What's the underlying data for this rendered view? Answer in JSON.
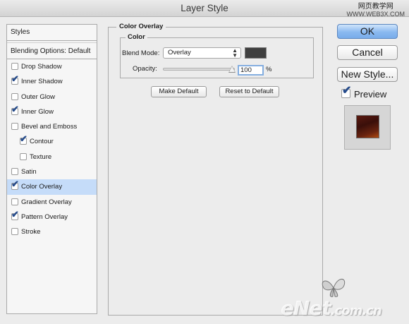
{
  "window": {
    "title": "Layer Style"
  },
  "watermark_top": {
    "line1": "网页教学网",
    "line2": "WWW.WEB3X.COM"
  },
  "left_panel": {
    "styles_label": "Styles",
    "blending_label": "Blending Options: Default",
    "items": [
      {
        "label": "Drop Shadow",
        "checked": false
      },
      {
        "label": "Inner Shadow",
        "checked": true
      },
      {
        "label": "Outer Glow",
        "checked": false
      },
      {
        "label": "Inner Glow",
        "checked": true
      },
      {
        "label": "Bevel and Emboss",
        "checked": false
      },
      {
        "label": "Contour",
        "checked": true,
        "sub": true
      },
      {
        "label": "Texture",
        "checked": false,
        "sub": true
      },
      {
        "label": "Satin",
        "checked": false
      },
      {
        "label": "Color Overlay",
        "checked": true,
        "selected": true
      },
      {
        "label": "Gradient Overlay",
        "checked": false
      },
      {
        "label": "Pattern Overlay",
        "checked": true
      },
      {
        "label": "Stroke",
        "checked": false
      }
    ]
  },
  "center": {
    "group_title": "Color Overlay",
    "color_title": "Color",
    "blend_mode_label": "Blend Mode:",
    "blend_mode_value": "Overlay",
    "swatch_color": "#3f3f3f",
    "opacity_label": "Opacity:",
    "opacity_value": "100",
    "opacity_unit": "%",
    "opacity_level": 1.0,
    "make_default": "Make Default",
    "reset_default": "Reset to Default"
  },
  "right": {
    "ok": "OK",
    "cancel": "Cancel",
    "new_style": "New Style...",
    "preview_label": "Preview",
    "preview_checked": true
  },
  "watermark_bottom": {
    "brand": "eNet",
    "domain": ".com.cn"
  },
  "colors": {
    "selection": "#c5dcf9",
    "ok_button": "#8ab9f0",
    "check": "#244a8a"
  }
}
